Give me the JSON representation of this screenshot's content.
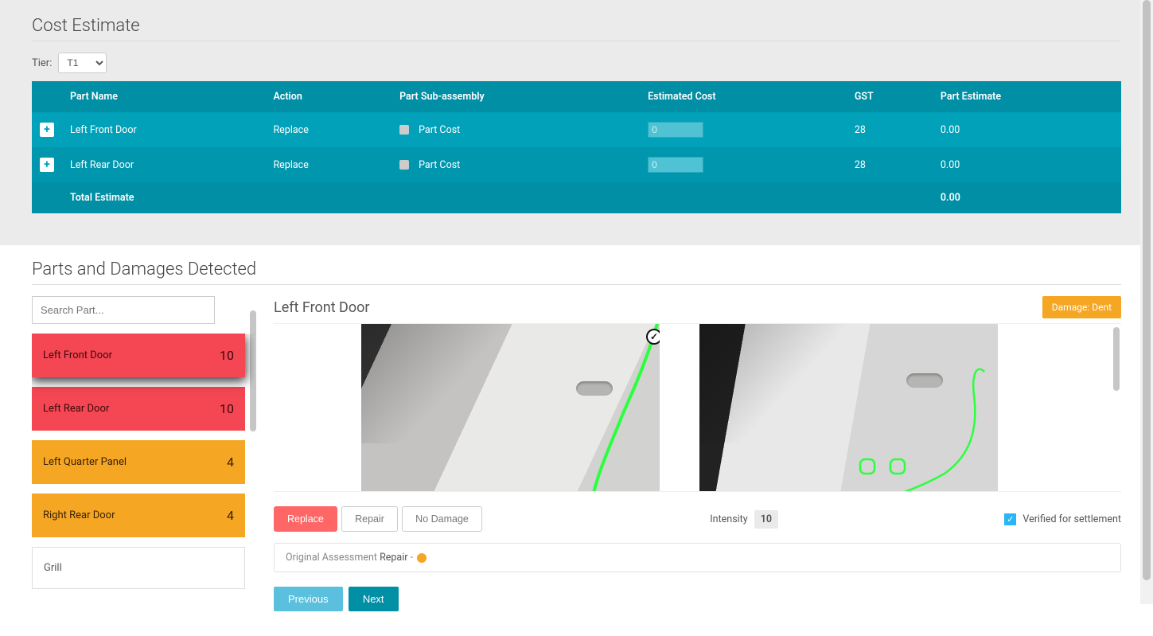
{
  "cost_section": {
    "title": "Cost Estimate",
    "tier_label": "Tier:",
    "tier_value": "T1",
    "columns": [
      "Part Name",
      "Action",
      "Part Sub-assembly",
      "Estimated Cost",
      "GST",
      "Part Estimate"
    ],
    "rows": [
      {
        "part": "Left Front Door",
        "action": "Replace",
        "sub": "Part Cost",
        "est": "0",
        "gst": "28",
        "partEst": "0.00"
      },
      {
        "part": "Left Rear Door",
        "action": "Replace",
        "sub": "Part Cost",
        "est": "0",
        "gst": "28",
        "partEst": "0.00"
      }
    ],
    "total_label": "Total Estimate",
    "total_value": "0.00"
  },
  "parts_section": {
    "title": "Parts and Damages Detected",
    "search_placeholder": "Search Part...",
    "items": [
      {
        "name": "Left Front Door",
        "count": "10",
        "style": "red",
        "active": true
      },
      {
        "name": "Left Rear Door",
        "count": "10",
        "style": "red",
        "active": false
      },
      {
        "name": "Left Quarter Panel",
        "count": "4",
        "style": "orange",
        "active": false
      },
      {
        "name": "Right Rear Door",
        "count": "4",
        "style": "orange",
        "active": false
      },
      {
        "name": "Grill",
        "count": "",
        "style": "plain",
        "active": false
      }
    ]
  },
  "detail": {
    "title": "Left Front Door",
    "damage_badge": "Damage: Dent",
    "actions": {
      "replace": "Replace",
      "repair": "Repair",
      "no_damage": "No Damage",
      "active": "replace"
    },
    "intensity_label": "Intensity",
    "intensity_value": "10",
    "verified_label": "Verified for settlement",
    "verified": true,
    "assessment_prefix": "Original Assessment ",
    "assessment_value": "Repair",
    "assessment_suffix": " - ",
    "nav": {
      "prev": "Previous",
      "next": "Next"
    }
  }
}
